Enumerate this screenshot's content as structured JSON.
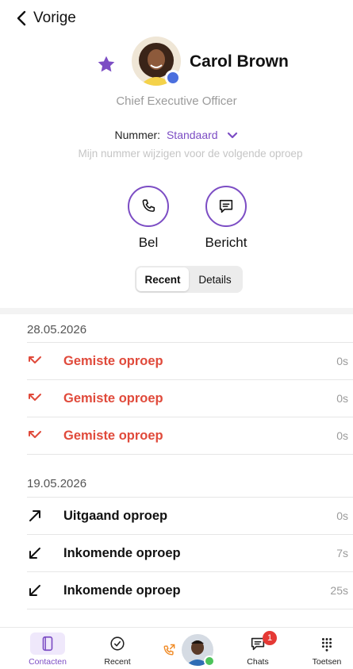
{
  "nav": {
    "back_label": "Vorige"
  },
  "contact": {
    "name": "Carol Brown",
    "role": "Chief Executive Officer",
    "favorite": true,
    "presence_color": "#4b6fde"
  },
  "number": {
    "label": "Nummer:",
    "value": "Standaard",
    "hint": "Mijn nummer wijzigen voor de volgende oproep"
  },
  "actions": [
    {
      "label": "Bel",
      "icon": "phone-icon"
    },
    {
      "label": "Bericht",
      "icon": "message-icon"
    }
  ],
  "segments": {
    "recent": "Recent",
    "details": "Details",
    "active": "Recent"
  },
  "history": [
    {
      "date": "28.05.2026",
      "calls": [
        {
          "type": "missed",
          "label": "Gemiste oproep",
          "duration": "0s",
          "icon": "missed-call-icon"
        },
        {
          "type": "missed",
          "label": "Gemiste oproep",
          "duration": "0s",
          "icon": "missed-call-icon"
        },
        {
          "type": "missed",
          "label": "Gemiste oproep",
          "duration": "0s",
          "icon": "missed-call-icon"
        }
      ]
    },
    {
      "date": "19.05.2026",
      "calls": [
        {
          "type": "outgoing",
          "label": "Uitgaand oproep",
          "duration": "0s",
          "icon": "outgoing-call-icon"
        },
        {
          "type": "incoming",
          "label": "Inkomende oproep",
          "duration": "7s",
          "icon": "incoming-call-icon"
        },
        {
          "type": "incoming",
          "label": "Inkomende oproep",
          "duration": "25s",
          "icon": "incoming-call-icon"
        }
      ]
    }
  ],
  "tabbar": {
    "tabs": [
      {
        "label": "Contacten",
        "icon": "contacts-book-icon",
        "active": true
      },
      {
        "label": "Recent",
        "icon": "recent-clock-icon",
        "active": false
      },
      {
        "label": "Chats",
        "icon": "chat-icon",
        "badge": "1",
        "active": false
      },
      {
        "label": "Toetsen",
        "icon": "keypad-icon",
        "active": false
      }
    ]
  },
  "colors": {
    "accent": "#7c4dc4",
    "missed": "#e04a3b",
    "muted": "#9b9b9b",
    "badge": "#e53935",
    "online": "#4cc35a"
  }
}
